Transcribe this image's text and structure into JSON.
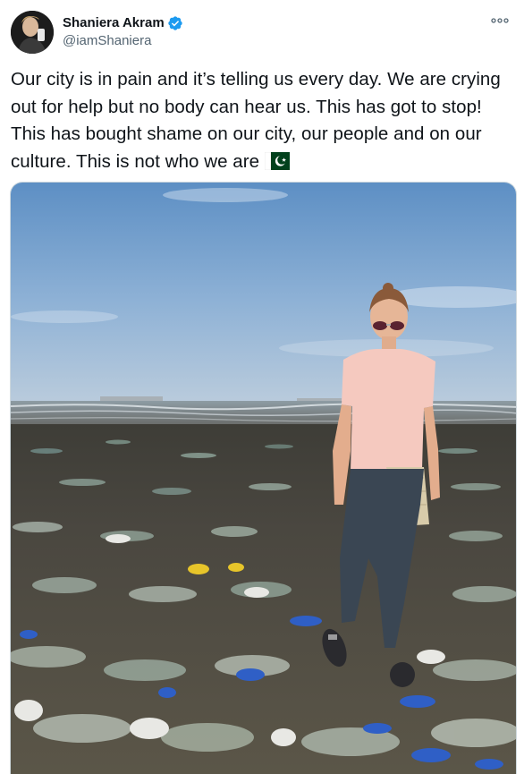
{
  "user": {
    "display_name": "Shaniera Akram",
    "handle": "@iamShaniera",
    "verified": true,
    "avatar_icon": "profile-photo"
  },
  "tweet": {
    "text": "Our city is in pain and it’s telling us every day. We are crying out for help but no body can hear us. This has got to stop! This has bought shame on our city, our people and on our culture. This is not who we are",
    "emoji": "flag-pakistan"
  },
  "media": {
    "description_icon": "photo-beach-litter"
  },
  "icons": {
    "more": "more-horizontal-icon",
    "verified": "verified-badge-icon"
  },
  "colors": {
    "verified": "#1d9bf0",
    "text": "#0f1419",
    "secondary": "#536471",
    "flag_green": "#01411c"
  }
}
